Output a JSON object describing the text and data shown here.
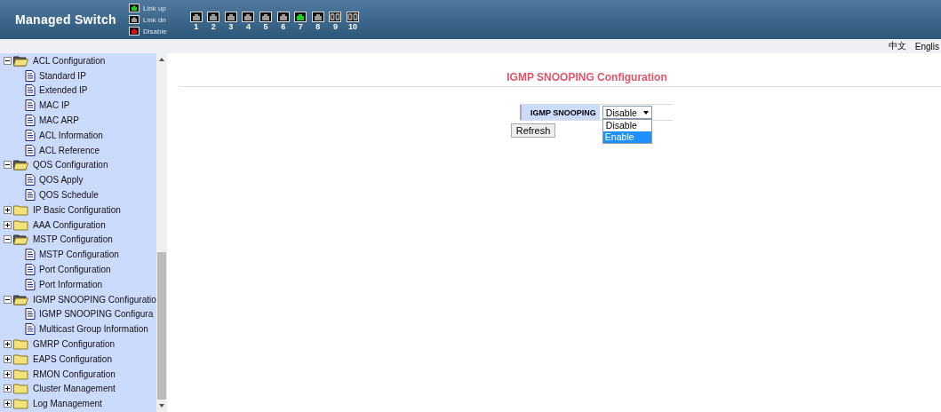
{
  "header": {
    "title": "Managed Switch",
    "legend": [
      {
        "label": "Link up",
        "color": "#22cc22"
      },
      {
        "label": "Link dn",
        "color": "#9a9a9a"
      },
      {
        "label": "Disable",
        "color": "#dd1111"
      }
    ],
    "ports": [
      {
        "label": "1",
        "kind": "copper",
        "color": "#9a9a9a"
      },
      {
        "label": "2",
        "kind": "copper",
        "color": "#9a9a9a"
      },
      {
        "label": "3",
        "kind": "copper",
        "color": "#9a9a9a"
      },
      {
        "label": "4",
        "kind": "copper",
        "color": "#9a9a9a"
      },
      {
        "label": "5",
        "kind": "copper",
        "color": "#9a9a9a"
      },
      {
        "label": "6",
        "kind": "copper",
        "color": "#9a9a9a"
      },
      {
        "label": "7",
        "kind": "copper",
        "color": "#22cc22"
      },
      {
        "label": "8",
        "kind": "copper",
        "color": "#9a9a9a"
      },
      {
        "label": "9",
        "kind": "fiber",
        "color": "#9a9a9a"
      },
      {
        "label": "10",
        "kind": "fiber",
        "color": "#9a9a9a"
      }
    ]
  },
  "languages": [
    {
      "label": "中文"
    },
    {
      "label": "Englis"
    }
  ],
  "sidebar": {
    "items": [
      {
        "label": "ACL Configuration",
        "expanded": true,
        "children": [
          {
            "label": "Standard IP"
          },
          {
            "label": "Extended IP"
          },
          {
            "label": "MAC IP"
          },
          {
            "label": "MAC ARP"
          },
          {
            "label": "ACL Information"
          },
          {
            "label": "ACL Reference"
          }
        ]
      },
      {
        "label": "QOS Configuration",
        "expanded": true,
        "children": [
          {
            "label": "QOS Apply"
          },
          {
            "label": "QOS Schedule"
          }
        ]
      },
      {
        "label": "IP Basic Configuration",
        "expanded": false
      },
      {
        "label": "AAA Configuration",
        "expanded": false
      },
      {
        "label": "MSTP Configuration",
        "expanded": true,
        "children": [
          {
            "label": "MSTP Configuration"
          },
          {
            "label": "Port Configuration"
          },
          {
            "label": "Port Information"
          }
        ]
      },
      {
        "label": "IGMP SNOOPING Configuratio",
        "expanded": true,
        "children": [
          {
            "label": "IGMP SNOOPING Configura"
          },
          {
            "label": "Multicast Group Information"
          }
        ]
      },
      {
        "label": "GMRP Configuration",
        "expanded": false
      },
      {
        "label": "EAPS Configuration",
        "expanded": false
      },
      {
        "label": "RMON Configuration",
        "expanded": false
      },
      {
        "label": "Cluster Management",
        "expanded": false
      },
      {
        "label": "Log Management",
        "expanded": false
      }
    ]
  },
  "content": {
    "title": "IGMP SNOOPING Configuration",
    "field": {
      "label": "IGMP SNOOPING",
      "value": "Disable",
      "expanded": true,
      "options": [
        {
          "label": "Disable",
          "selected": true,
          "highlighted": false
        },
        {
          "label": "Enable",
          "selected": false,
          "highlighted": true
        }
      ]
    },
    "buttons": [
      {
        "label": "Refresh"
      }
    ]
  }
}
